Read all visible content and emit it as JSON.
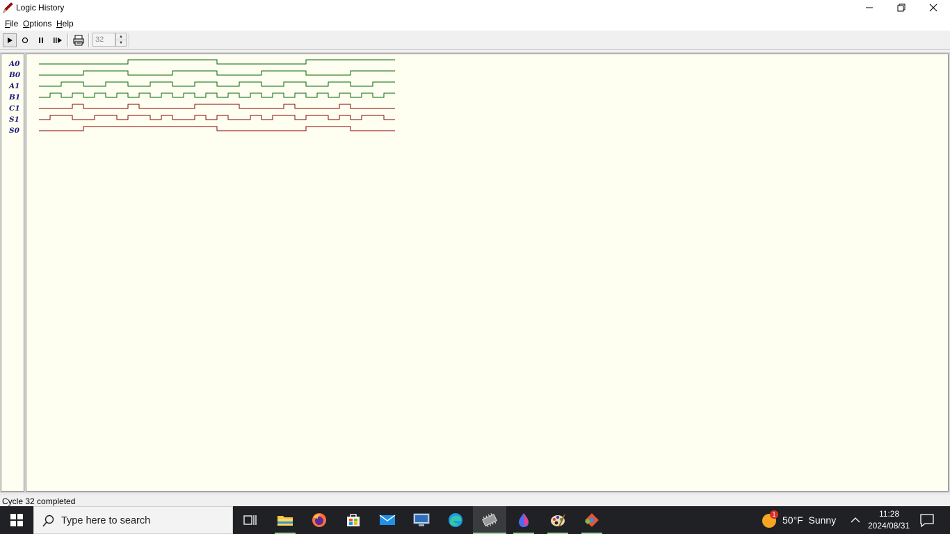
{
  "window": {
    "title": "Logic History"
  },
  "menu": [
    {
      "label": "File",
      "accel": "F",
      "rest": "ile"
    },
    {
      "label": "Options",
      "accel": "O",
      "rest": "ptions"
    },
    {
      "label": "Help",
      "accel": "H",
      "rest": "elp"
    }
  ],
  "toolbar": {
    "buttons": [
      "play-icon",
      "record-icon",
      "pause-icon",
      "step-icon",
      "print-icon"
    ],
    "cycle_count_value": "32"
  },
  "signals": [
    {
      "name": "A0",
      "color": "#006400",
      "levels": "00000000111111110000000011111111"
    },
    {
      "name": "B0",
      "color": "#006400",
      "levels": "00001111000011110000111100001111"
    },
    {
      "name": "A1",
      "color": "#006400",
      "levels": "00110011001100110011001100110011"
    },
    {
      "name": "B1",
      "color": "#006400",
      "levels": "01010101010101010101010101010101"
    },
    {
      "name": "C1",
      "color": "#8b0000",
      "levels": "00010000100000111100001000010000"
    },
    {
      "name": "S1",
      "color": "#8b0000",
      "levels": "01100110110100101001011011010110"
    },
    {
      "name": "S0",
      "color": "#8b0000",
      "levels": "00001111111111110000000011110000"
    }
  ],
  "status": {
    "text": "Cycle 32 completed"
  },
  "taskbar": {
    "search_placeholder": "Type here to search",
    "apps": [
      "task-view-icon",
      "file-explorer-icon",
      "firefox-icon",
      "store-icon",
      "mail-icon",
      "remote-desktop-icon",
      "edge-icon",
      "logic-simulator-icon",
      "paint-drop-icon",
      "palette-icon",
      "git-icon"
    ],
    "weather": {
      "temp": "50°F",
      "condition": "Sunny",
      "badge": "1"
    },
    "clock": {
      "time": "11:28",
      "date": "2024/08/31"
    }
  }
}
